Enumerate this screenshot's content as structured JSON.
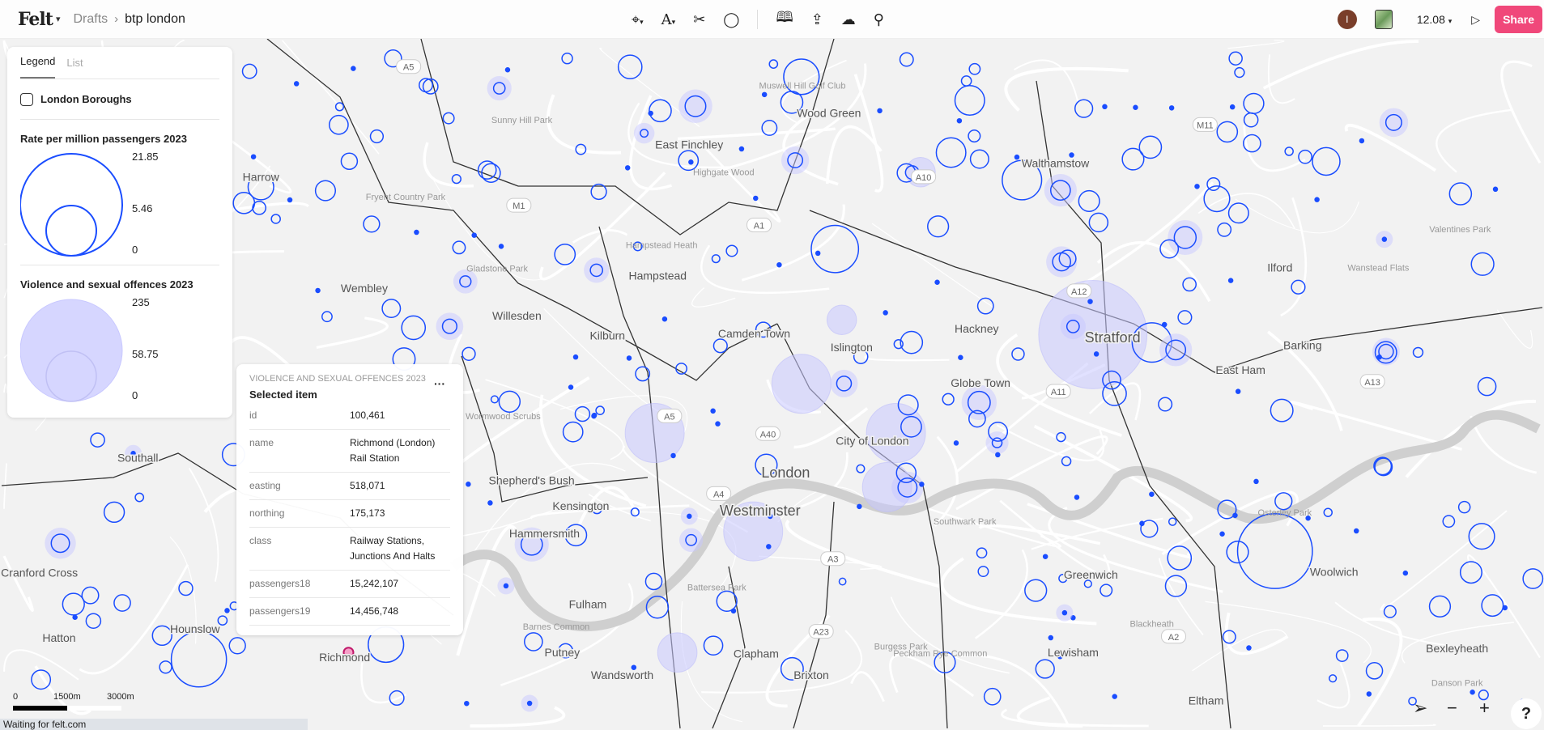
{
  "topbar": {
    "logo": "Felt",
    "breadcrumb": [
      "Drafts",
      "btp london"
    ],
    "tools": [
      "pin-icon",
      "text-icon",
      "scissors-icon",
      "comment-icon",
      "library-icon",
      "upload-icon",
      "cloud-icon",
      "search-icon"
    ],
    "avatar_initial": "I",
    "zoom_level": "12.08",
    "share_label": "Share",
    "accent": "#f0487a"
  },
  "legend": {
    "tabs": [
      "Legend",
      "List"
    ],
    "layer_toggle": "London Boroughs",
    "sections": [
      {
        "title": "Rate per million passengers 2023",
        "values": [
          "21.85",
          "5.46",
          "0"
        ],
        "color": "#1a4dff"
      },
      {
        "title": "Violence and sexual offences 2023",
        "values": [
          "235",
          "58.75",
          "0"
        ],
        "color": "#d6d6ff"
      }
    ]
  },
  "popup": {
    "layer": "VIOLENCE AND SEXUAL OFFENCES 2023",
    "subtitle": "Selected item",
    "rows": [
      {
        "k": "id",
        "v": "100,461"
      },
      {
        "k": "name",
        "v": "Richmond (London) Rail Station"
      },
      {
        "k": "easting",
        "v": "518,071"
      },
      {
        "k": "northing",
        "v": "175,173"
      },
      {
        "k": "class",
        "v": "Railway Stations, Junctions And Halts"
      },
      {
        "k": "passengers18",
        "v": "15,242,107"
      },
      {
        "k": "passengers19",
        "v": "14,456,748"
      }
    ]
  },
  "map": {
    "places": [
      "Harrow",
      "Wembley",
      "Willesden",
      "Hampstead",
      "Kilburn",
      "Camden Town",
      "Islington",
      "Hackney",
      "Stratford",
      "Walthamstow",
      "Wood Green",
      "East Finchley",
      "Ilford",
      "East Ham",
      "Barking",
      "Globe Town",
      "City of London",
      "London",
      "Westminster",
      "Kensington",
      "Shepherd's Bush",
      "Hammersmith",
      "Southall",
      "Fulham",
      "Putney",
      "Wandsworth",
      "Clapham",
      "Brixton",
      "Lewisham",
      "Greenwich",
      "Woolwich",
      "Hounslow",
      "Richmond",
      "Eltham",
      "Cranford Cross",
      "Bexleyheath",
      "Hatton"
    ],
    "minor_places": [
      "Gladstone Park",
      "Hampstead Heath",
      "Wormwood Scrubs",
      "Battersea Park",
      "Burgess Park",
      "Southwark Park",
      "Fryent Country Park",
      "Highgate Wood",
      "Valentines Park",
      "Wanstead Flats",
      "Osterley Park",
      "Barnes Common",
      "Peckham Rye Common",
      "Blackheath",
      "Danson Park",
      "Sunny Hill Park",
      "Muswell Hill Golf Club"
    ],
    "roads": [
      "A5",
      "M1",
      "A1",
      "A10",
      "A12",
      "M11",
      "A11",
      "A13",
      "A40",
      "A4",
      "A3",
      "A23",
      "A2",
      "A5"
    ]
  },
  "scale": [
    "0",
    "1500m",
    "3000m"
  ],
  "controls": {
    "help": "?"
  },
  "status": "Waiting for felt.com"
}
